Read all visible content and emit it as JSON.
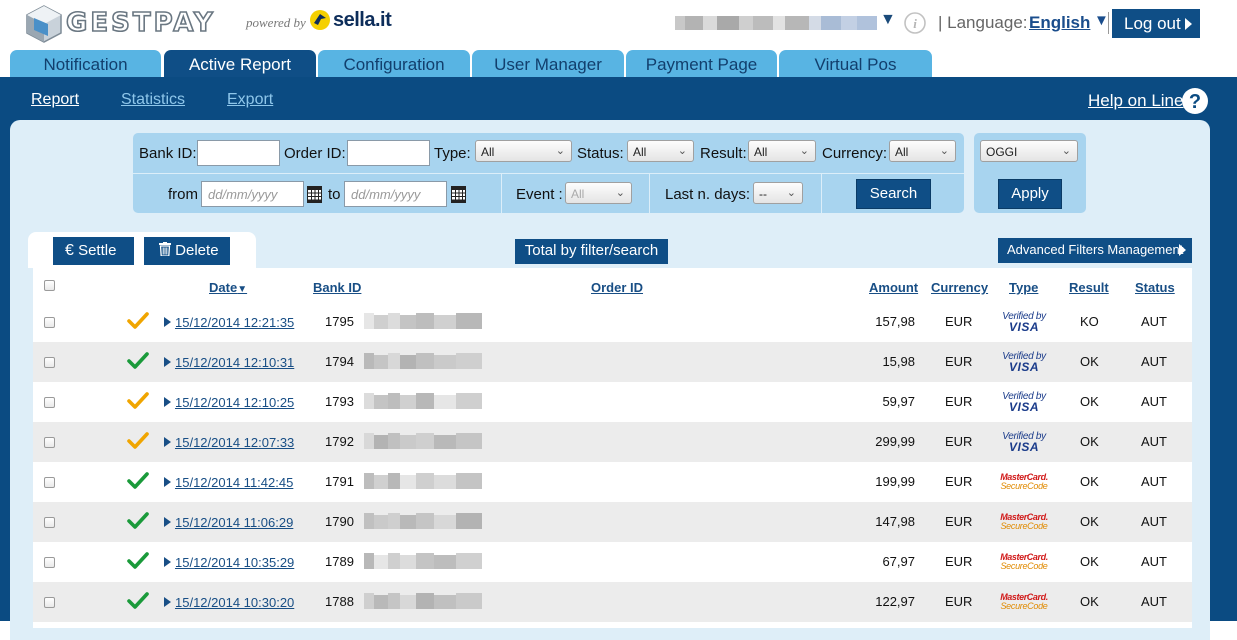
{
  "header": {
    "brand": "GESTPAY",
    "powered_by": "powered by",
    "partner": "sella.it",
    "language_label": "Language:",
    "language_value": "English",
    "logout_label": "Log out"
  },
  "tabs": [
    {
      "label": "Notification",
      "active": false
    },
    {
      "label": "Active Report",
      "active": true
    },
    {
      "label": "Configuration",
      "active": false
    },
    {
      "label": "User Manager",
      "active": false
    },
    {
      "label": "Payment Page",
      "active": false
    },
    {
      "label": "Virtual Pos",
      "active": false
    }
  ],
  "subnav": {
    "items": [
      {
        "label": "Report",
        "active": true
      },
      {
        "label": "Statistics",
        "active": false
      },
      {
        "label": "Export",
        "active": false
      }
    ],
    "help_label": "Help on Line"
  },
  "filters": {
    "bank_id_label": "Bank ID:",
    "order_id_label": "Order ID:",
    "type_label": "Type:",
    "type_value": "All",
    "status_label": "Status:",
    "status_value": "All",
    "result_label": "Result:",
    "result_value": "All",
    "currency_label": "Currency:",
    "currency_value": "All",
    "from_label": "from",
    "from_placeholder": "dd/mm/yyyy",
    "to_label": "to",
    "to_placeholder": "dd/mm/yyyy",
    "event_label": "Event :",
    "event_value": "All",
    "last_days_label": "Last n. days:",
    "last_days_value": "--",
    "search_label": "Search",
    "period_value": "OGGI",
    "apply_label": "Apply"
  },
  "toolbar": {
    "settle_label": "Settle",
    "delete_label": "Delete",
    "total_label": "Total by filter/search",
    "advanced_label": "Advanced Filters Management"
  },
  "table": {
    "columns": {
      "date": "Date",
      "bank_id": "Bank ID",
      "order_id": "Order ID",
      "amount": "Amount",
      "currency": "Currency",
      "type": "Type",
      "result": "Result",
      "status": "Status"
    },
    "rows": [
      {
        "check_color": "#f0a500",
        "date": "15/12/2014 12:21:35",
        "bank_id": "1795",
        "amount": "157,98",
        "currency": "EUR",
        "type": "visa",
        "result": "KO",
        "status": "AUT"
      },
      {
        "check_color": "#1a9a3a",
        "date": "15/12/2014 12:10:31",
        "bank_id": "1794",
        "amount": "15,98",
        "currency": "EUR",
        "type": "visa",
        "result": "OK",
        "status": "AUT"
      },
      {
        "check_color": "#f0a500",
        "date": "15/12/2014 12:10:25",
        "bank_id": "1793",
        "amount": "59,97",
        "currency": "EUR",
        "type": "visa",
        "result": "OK",
        "status": "AUT"
      },
      {
        "check_color": "#f0a500",
        "date": "15/12/2014 12:07:33",
        "bank_id": "1792",
        "amount": "299,99",
        "currency": "EUR",
        "type": "visa",
        "result": "OK",
        "status": "AUT"
      },
      {
        "check_color": "#1a9a3a",
        "date": "15/12/2014 11:42:45",
        "bank_id": "1791",
        "amount": "199,99",
        "currency": "EUR",
        "type": "mastercard",
        "result": "OK",
        "status": "AUT"
      },
      {
        "check_color": "#1a9a3a",
        "date": "15/12/2014 11:06:29",
        "bank_id": "1790",
        "amount": "147,98",
        "currency": "EUR",
        "type": "mastercard",
        "result": "OK",
        "status": "AUT"
      },
      {
        "check_color": "#1a9a3a",
        "date": "15/12/2014 10:35:29",
        "bank_id": "1789",
        "amount": "67,97",
        "currency": "EUR",
        "type": "mastercard",
        "result": "OK",
        "status": "AUT"
      },
      {
        "check_color": "#1a9a3a",
        "date": "15/12/2014 10:30:20",
        "bank_id": "1788",
        "amount": "122,97",
        "currency": "EUR",
        "type": "mastercard",
        "result": "OK",
        "status": "AUT"
      }
    ],
    "visa_line1": "Verified by",
    "visa_line2": "VISA",
    "mc_line1": "MasterCard.",
    "mc_line2": "SecureCode"
  },
  "colors": {
    "primary": "#0f4e86",
    "tab_inactive": "#58b4e3",
    "panel_bg": "#deeef8",
    "filter_bg": "#a8d4ef",
    "check_green": "#1a9a3a",
    "check_orange": "#f0a500"
  },
  "icons": {
    "logo": "gestpay-cube-icon",
    "partner": "sella-bird-icon",
    "info": "info-icon",
    "help": "help-circle-icon",
    "calendar": "calendar-icon",
    "settle": "euro-icon",
    "delete": "trash-icon",
    "row_status": "checkmark-icon"
  }
}
